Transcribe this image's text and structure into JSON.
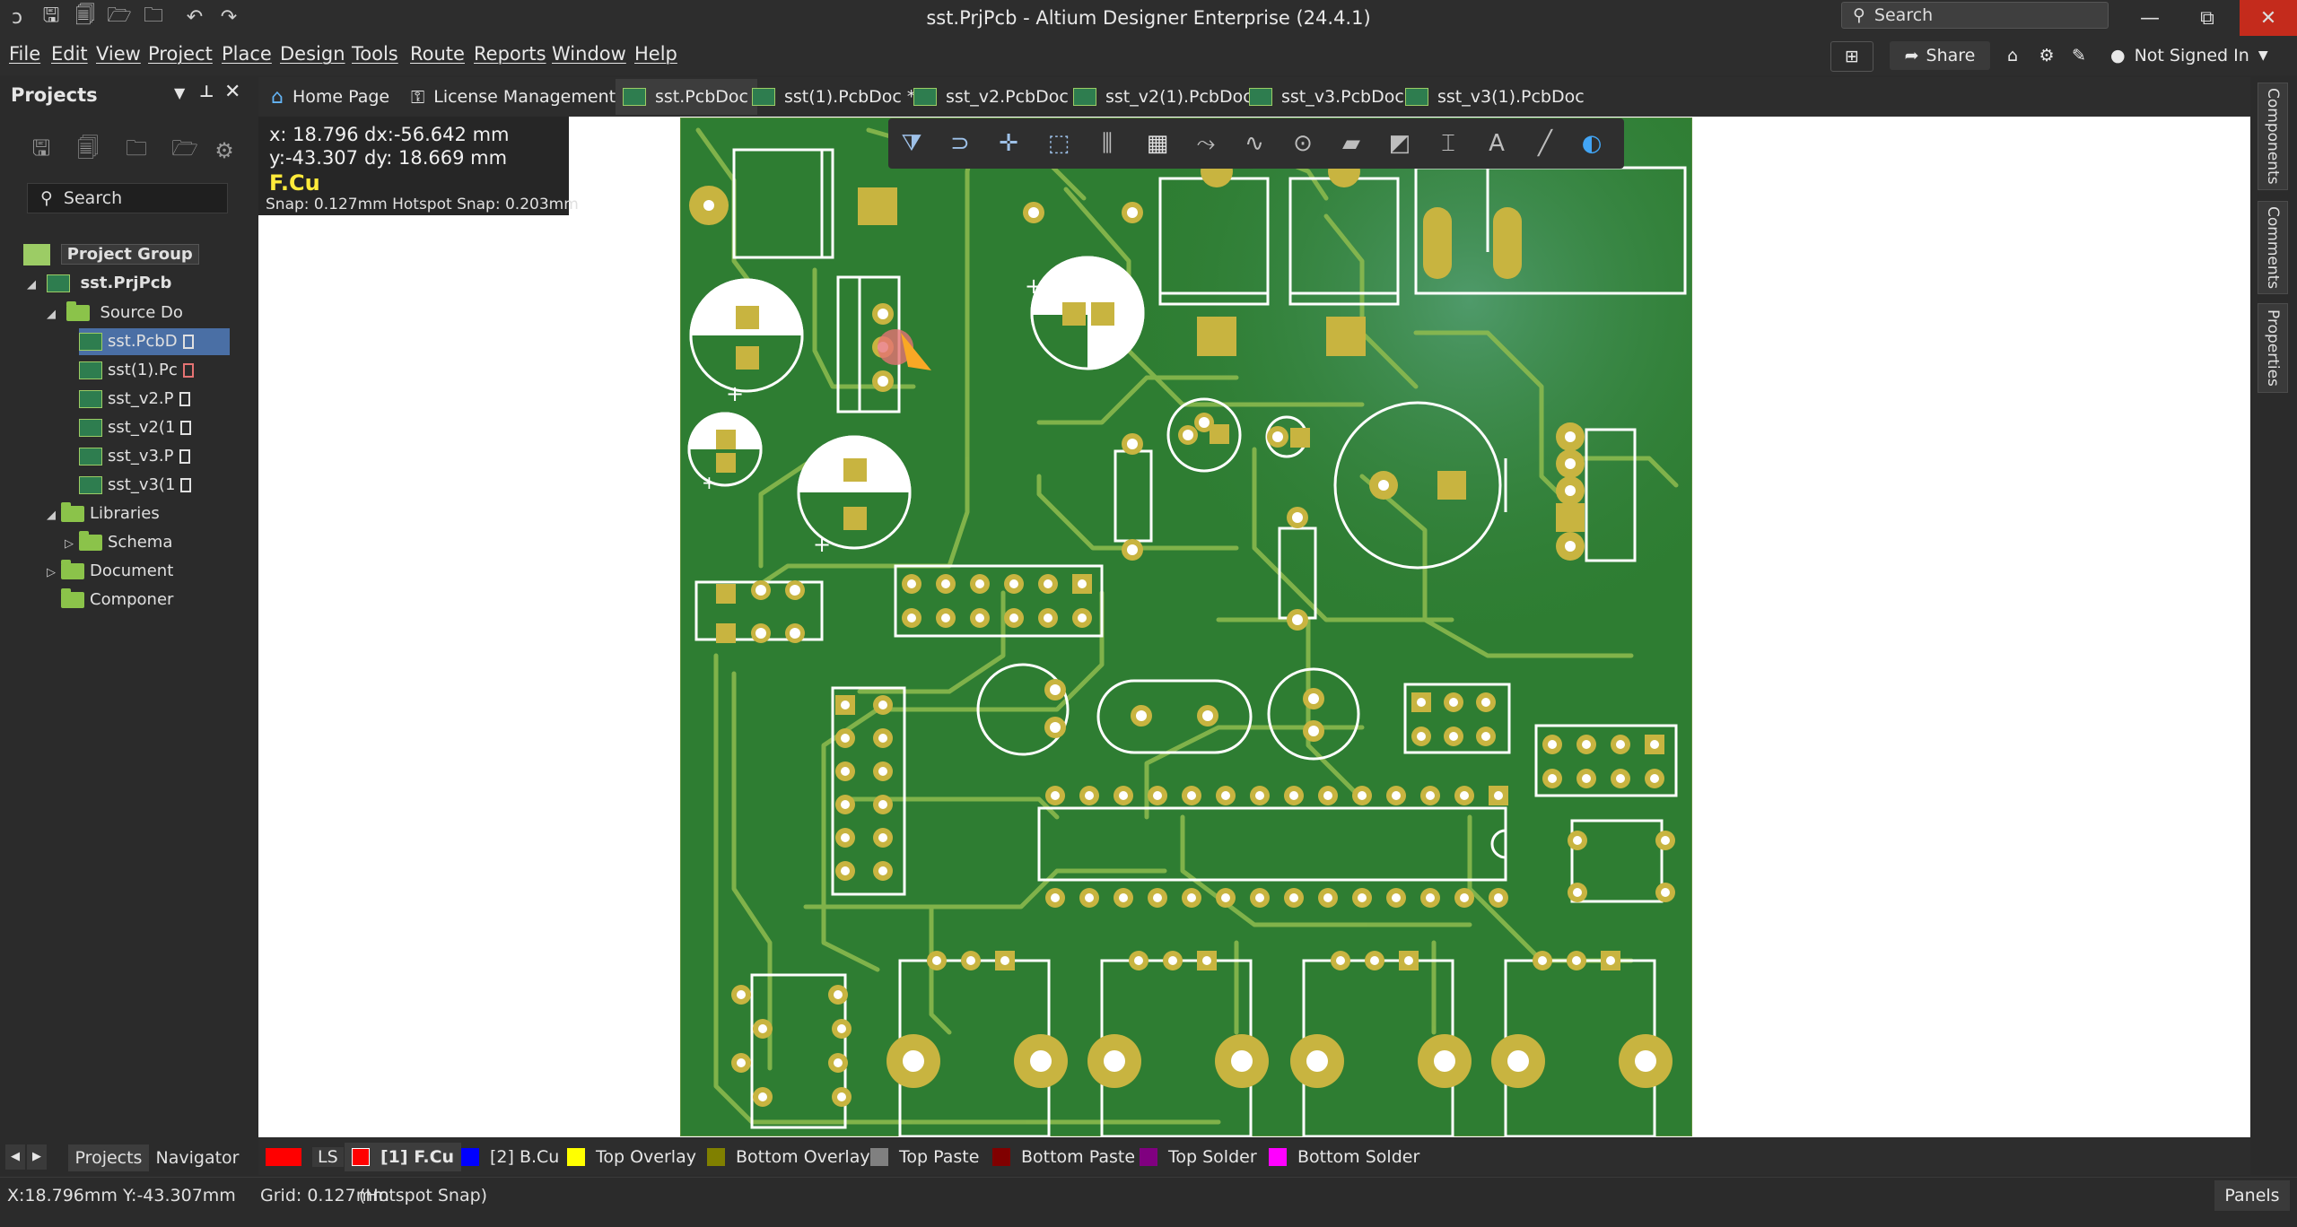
{
  "window": {
    "title": "sst.PrjPcb - Altium Designer Enterprise (24.4.1)",
    "search_placeholder": "Search",
    "minimize": "—",
    "restore": "⧉",
    "close": "✕"
  },
  "menu": [
    "File",
    "Edit",
    "View",
    "Project",
    "Place",
    "Design",
    "Tools",
    "Route",
    "Reports",
    "Window",
    "Help"
  ],
  "top_right": {
    "share": "Share",
    "user": "Not Signed In"
  },
  "projects_panel": {
    "title": "Projects",
    "search_placeholder": "Search",
    "tree": {
      "group": "Project Group",
      "project": "sst.PrjPcb",
      "source_folder": "Source Do",
      "documents": [
        "sst.PcbD",
        "sst(1).Pc",
        "sst_v2.P",
        "sst_v2(1",
        "sst_v3.P",
        "sst_v3(1"
      ],
      "libraries": "Libraries",
      "schematic": "Schema",
      "documentation": "Document",
      "components": "Componer"
    },
    "bottom_tabs": [
      "Projects",
      "Navigator"
    ]
  },
  "doc_tabs": [
    "Home Page",
    "License Management",
    "sst.PcbDoc",
    "sst(1).PcbDoc *",
    "sst_v2.PcbDoc",
    "sst_v2(1).PcbDoc",
    "sst_v3.PcbDoc",
    "sst_v3(1).PcbDoc"
  ],
  "side_panels": [
    "Components",
    "Comments",
    "Properties"
  ],
  "hud": {
    "x": "x: 18.796",
    "dx": "dx:-56.642 mm",
    "y": "y:-43.307",
    "dy": "dy: 18.669 mm",
    "layer": "F.Cu",
    "snap": "Snap: 0.127mm Hotspot Snap: 0.203mm"
  },
  "layers": [
    {
      "label": "LS",
      "color": "#ff0000"
    },
    {
      "label": "[1] F.Cu",
      "color": "#ff0000",
      "active": true
    },
    {
      "label": "[2] B.Cu",
      "color": "#0000ff"
    },
    {
      "label": "Top Overlay",
      "color": "#ffff00"
    },
    {
      "label": "Bottom Overlay",
      "color": "#808000"
    },
    {
      "label": "Top Paste",
      "color": "#808080"
    },
    {
      "label": "Bottom Paste",
      "color": "#800000"
    },
    {
      "label": "Top Solder",
      "color": "#800080"
    },
    {
      "label": "Bottom Solder",
      "color": "#ff00ff"
    }
  ],
  "colors": {
    "board": "#2e7d32",
    "pad": "#c8b440",
    "trace": "#8fbc4f",
    "silk": "#ffffff"
  },
  "status": {
    "coords": "X:18.796mm Y:-43.307mm",
    "grid": "Grid: 0.127mm",
    "snap": "(Hotspot Snap)",
    "panels": "Panels"
  }
}
